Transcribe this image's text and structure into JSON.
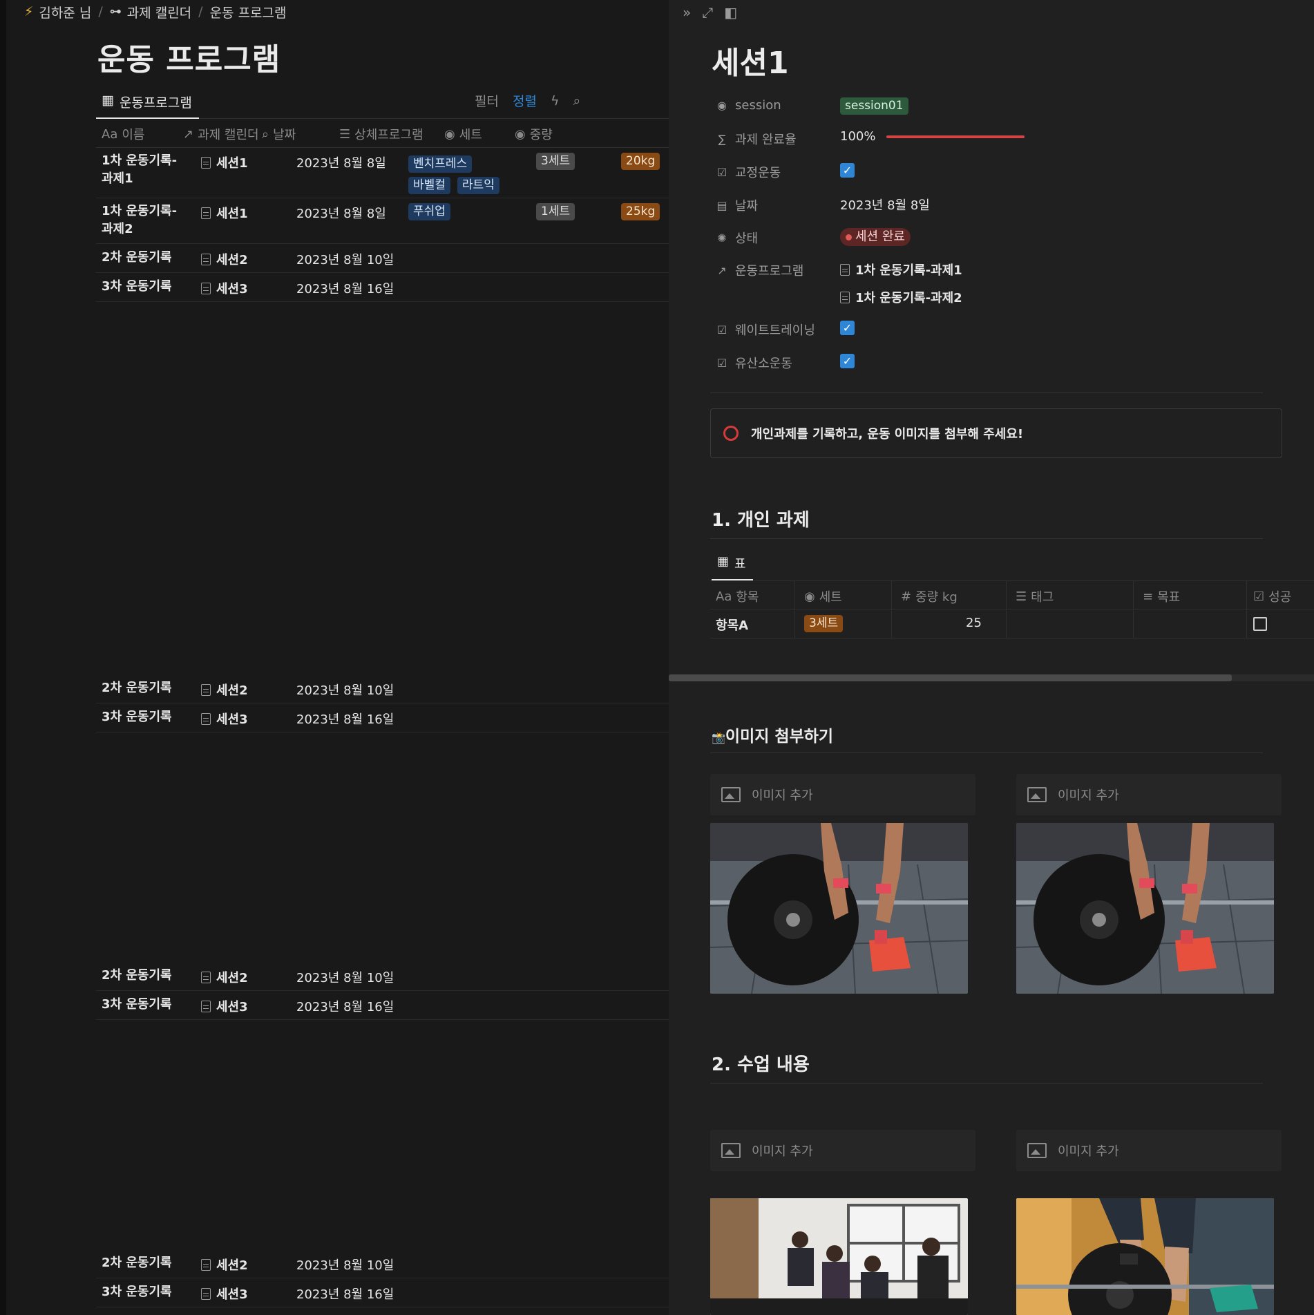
{
  "breadcrumb": {
    "user": "김하준 님",
    "calendar": "과제 캘린더",
    "page": "운동 프로그램"
  },
  "page_title": "운동 프로그램",
  "view": {
    "tab_label": "운동프로그램",
    "filter": "필터",
    "sort": "정렬"
  },
  "columns": {
    "name": "이름",
    "calendar": "과제 캘린더",
    "date": "날짜",
    "detail": "상체프로그램",
    "sets": "세트",
    "weight": "중량",
    "name_prefix": "Aa"
  },
  "rows": [
    {
      "name": "1차 운동기록-과제1",
      "session": "세션1",
      "date": "2023년 8월 8일",
      "tags": [
        "벤치프레스",
        "바벨컬",
        "라트익"
      ],
      "sets": "3세트",
      "weight": "20kg"
    },
    {
      "name": "1차 운동기록-과제2",
      "session": "세션1",
      "date": "2023년 8월 8일",
      "tags": [
        "푸쉬업"
      ],
      "sets": "1세트",
      "weight": "25kg"
    },
    {
      "name": "2차 운동기록",
      "session": "세션2",
      "date": "2023년 8월 10일"
    },
    {
      "name": "3차 운동기록",
      "session": "세션3",
      "date": "2023년 8월 16일"
    }
  ],
  "side": {
    "title": "세션1",
    "props": {
      "session_label": "session",
      "session_value": "session01",
      "completion_label": "과제 완료율",
      "completion_value": "100%",
      "completion_fraction": 1.0,
      "corrective_label": "교정운동",
      "date_label": "날짜",
      "date_value": "2023년 8월 8일",
      "status_label": "상태",
      "status_value": "세션 완료",
      "program_label": "운동프로그램",
      "program_1": "1차 운동기록-과제1",
      "program_2": "1차 운동기록-과제2",
      "weight_label": "웨이트트레이닝",
      "aerobic_label": "유산소운동"
    },
    "callout": "개인과제를 기록하고, 운동 이미지를 첨부해 주세요!",
    "section1": "1. 개인 과제",
    "subtable": {
      "tab": "표",
      "headers": {
        "item": "항목",
        "sets": "세트",
        "weight": "중량 kg",
        "tag": "태그",
        "goal": "목표",
        "success": "성공"
      },
      "row": {
        "item": "항목A",
        "sets": "3세트",
        "weight": "25"
      }
    },
    "images_heading": "이미지 첨부하기",
    "add_image": "이미지 추가",
    "section2": "2. 수업 내용"
  },
  "colors": {
    "background": "#191919",
    "panel": "#202020",
    "accent_blue": "#2f86d6",
    "status_red": "#5e2525",
    "tag_orange": "#8a4a14"
  }
}
